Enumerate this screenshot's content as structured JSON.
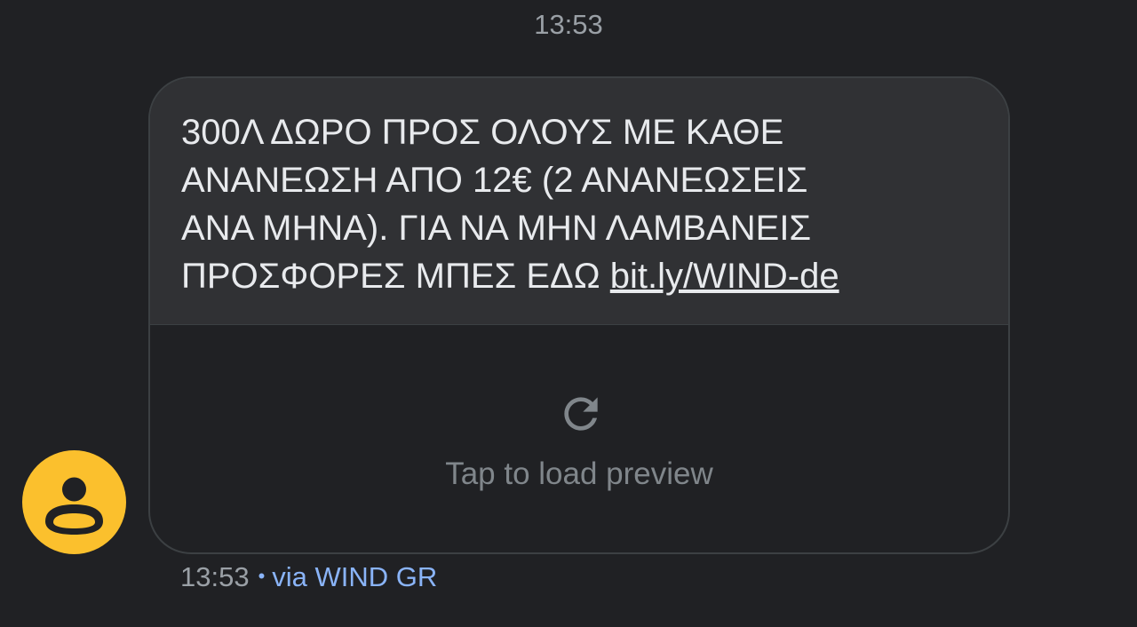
{
  "conversation": {
    "top_timestamp": "13:53"
  },
  "message": {
    "text_lines": [
      "300Λ ΔΩΡΟ ΠΡΟΣ ΟΛΟΥΣ ΜΕ ΚΑΘΕ",
      "ΑΝΑΝΕΩΣΗ ΑΠΟ 12€ (2 ΑΝΑΝΕΩΣΕΙΣ",
      "ΑΝΑ ΜΗΝΑ). ΓΙΑ ΝΑ ΜΗΝ ΛΑΜΒΑΝΕΙΣ",
      "ΠΡΟΣΦΟΡΕΣ ΜΠΕΣ ΕΔΩ "
    ],
    "link_text": "bit.ly/WIND-de",
    "preview": {
      "icon": "refresh-icon",
      "label": "Tap to load preview"
    },
    "footer": {
      "time": "13:53",
      "separator": "•",
      "via": "via WIND GR"
    }
  },
  "sender": {
    "avatar_icon": "person-icon",
    "avatar_color": "#fbc02d"
  },
  "colors": {
    "background": "#202124",
    "bubble": "#303134",
    "text": "#e8eaed",
    "muted": "#9aa0a6",
    "accent": "#8ab4f8"
  }
}
